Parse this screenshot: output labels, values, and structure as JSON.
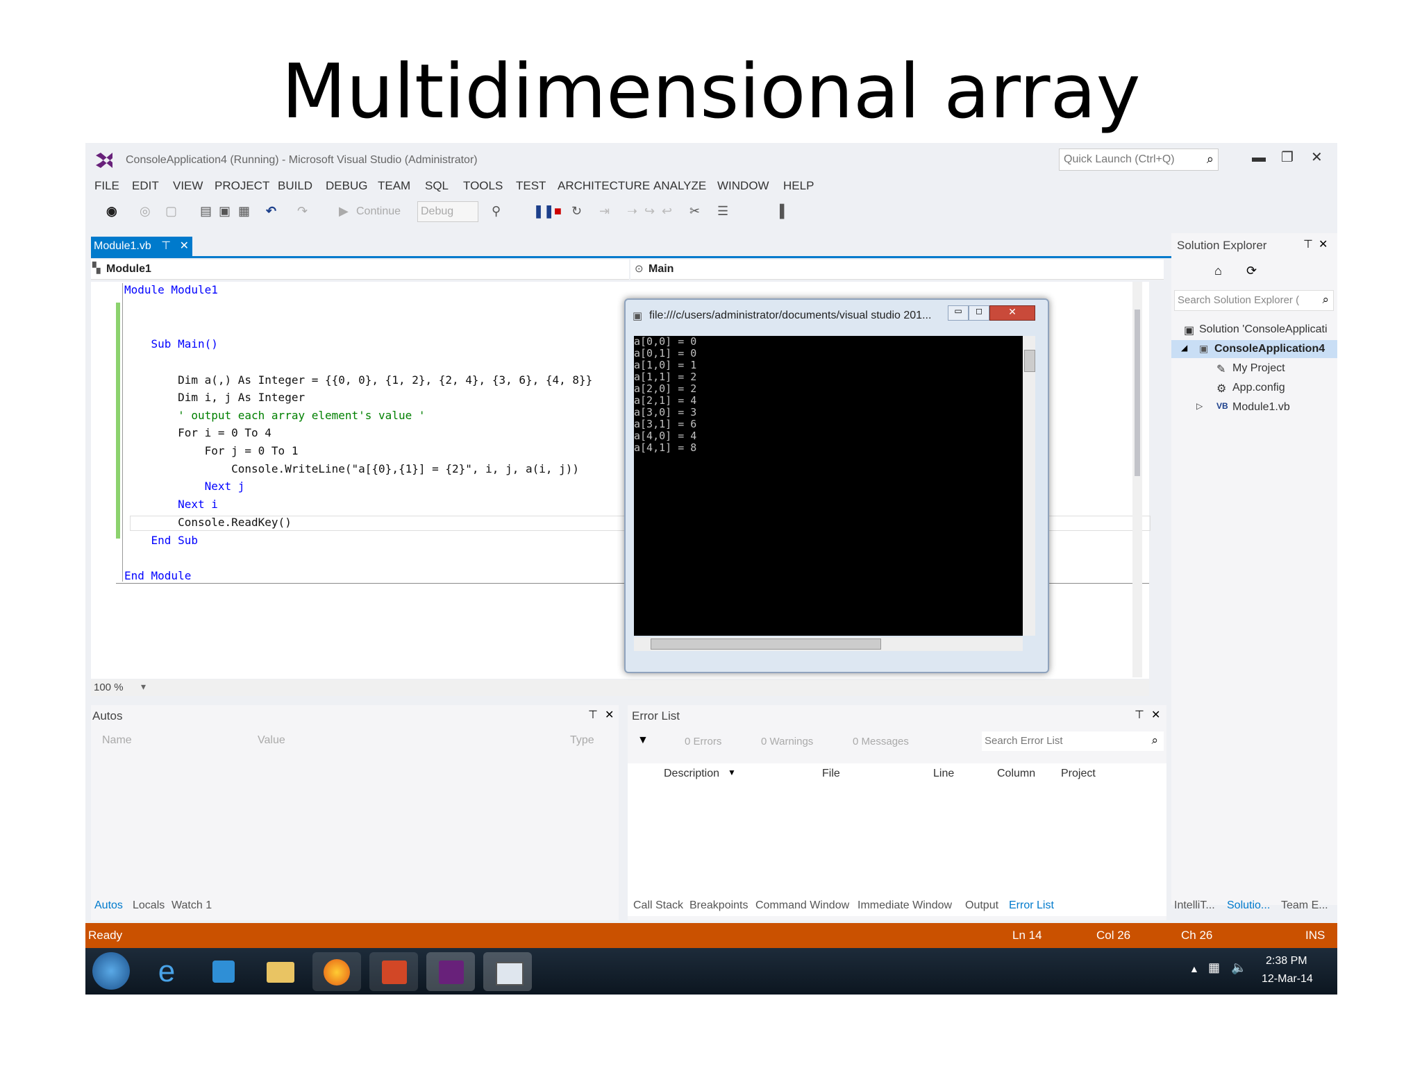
{
  "slide": {
    "title": "Multidimensional array"
  },
  "window": {
    "title": "ConsoleApplication4 (Running) - Microsoft Visual Studio (Administrator)",
    "quick_launch_placeholder": "Quick Launch (Ctrl+Q)"
  },
  "menu": [
    "FILE",
    "EDIT",
    "VIEW",
    "PROJECT",
    "BUILD",
    "DEBUG",
    "TEAM",
    "SQL",
    "TOOLS",
    "TEST",
    "ARCHITECTURE",
    "ANALYZE",
    "WINDOW",
    "HELP"
  ],
  "toolbar": {
    "continue_label": "Continue",
    "config_value": "Debug"
  },
  "editor": {
    "tab_label": "Module1.vb",
    "tab_pin": "⊤",
    "tab_close": "✕",
    "module_dropdown": "Module1",
    "member_dropdown": "Main",
    "zoom": "100 %"
  },
  "code": [
    "Module Module1",
    "",
    "",
    "    Sub Main()",
    "",
    "        Dim a(,) As Integer = {{0, 0}, {1, 2}, {2, 4}, {3, 6}, {4, 8}}",
    "        Dim i, j As Integer",
    "        ' output each array element's value '",
    "        For i = 0 To 4",
    "            For j = 0 To 1",
    "                Console.WriteLine(\"a[{0},{1}] = {2}\", i, j, a(i, j))",
    "            Next j",
    "        Next i",
    "        Console.ReadKey()",
    "    End Sub",
    "",
    "End Module"
  ],
  "console": {
    "title": "file:///c/users/administrator/documents/visual studio 201...",
    "lines": [
      "a[0,0] = 0",
      "a[0,1] = 0",
      "a[1,0] = 1",
      "a[1,1] = 2",
      "a[2,0] = 2",
      "a[2,1] = 4",
      "a[3,0] = 3",
      "a[3,1] = 6",
      "a[4,0] = 4",
      "a[4,1] = 8"
    ]
  },
  "solution_explorer": {
    "title": "Solution Explorer",
    "search_placeholder": "Search Solution Explorer (",
    "items": [
      "Solution 'ConsoleApplicati",
      "ConsoleApplication4",
      "My Project",
      "App.config",
      "Module1.vb"
    ],
    "bottom_tabs": [
      "IntelliT...",
      "Solutio...",
      "Team E..."
    ]
  },
  "autos": {
    "title": "Autos",
    "columns": [
      "Name",
      "Value",
      "Type"
    ],
    "tabs": [
      "Autos",
      "Locals",
      "Watch 1"
    ]
  },
  "error_list": {
    "title": "Error List",
    "errors": "0 Errors",
    "warnings": "0 Warnings",
    "messages": "0 Messages",
    "search_placeholder": "Search Error List",
    "columns": [
      "Description",
      "File",
      "Line",
      "Column",
      "Project"
    ],
    "tabs": [
      "Call Stack",
      "Breakpoints",
      "Command Window",
      "Immediate Window",
      "Output",
      "Error List"
    ]
  },
  "status": {
    "ready": "Ready",
    "line": "Ln 14",
    "col": "Col 26",
    "ch": "Ch 26",
    "mode": "INS"
  },
  "taskbar": {
    "time": "2:38 PM",
    "date": "12-Mar-14"
  },
  "colors": {
    "accent": "#007acc",
    "status_bar": "#ca5100",
    "console_bg": "#000000"
  }
}
